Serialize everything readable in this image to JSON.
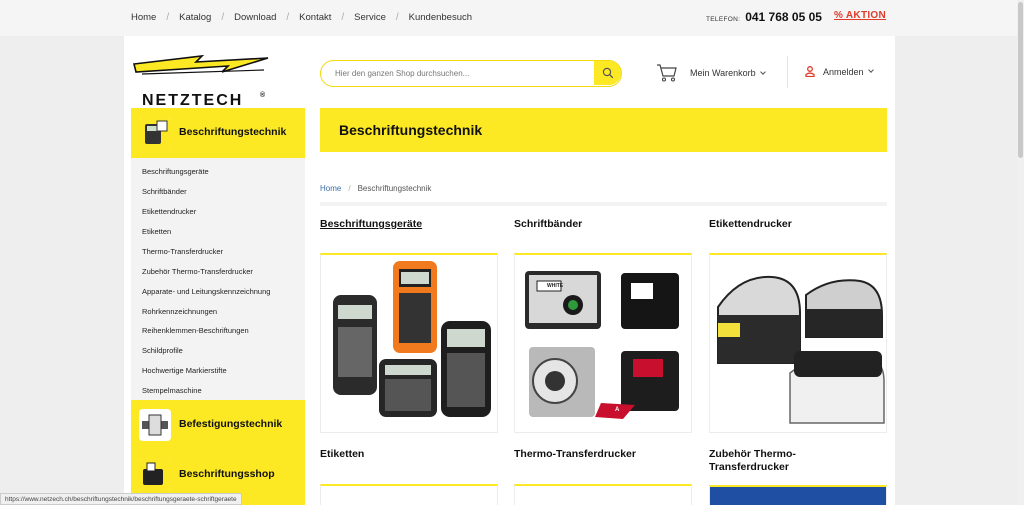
{
  "topnav": {
    "items": [
      "Home",
      "Katalog",
      "Download",
      "Kontakt",
      "Service",
      "Kundenbesuch"
    ],
    "phone_label": "TELEFON:",
    "phone_number": "041 768 05 05",
    "aktion": "% AKTION"
  },
  "header": {
    "logo_text": "NETZTECH",
    "search_placeholder": "Hier den ganzen Shop durchsuchen...",
    "cart_label": "Mein Warenkorb",
    "login_label": "Anmelden"
  },
  "sidebar": {
    "categories": [
      "Beschriftungstechnik",
      "Befestigungstechnik",
      "Beschriftungsshop"
    ],
    "subitems": [
      "Beschriftungsgeräte",
      "Schriftbänder",
      "Etikettendrucker",
      "Etiketten",
      "Thermo-Transferdrucker",
      "Zubehör Thermo-Transferdrucker",
      "Apparate- und Leitungskennzeichnung",
      "Rohrkennzeichnungen",
      "Reihenklemmen-Beschriftungen",
      "Schildprofile",
      "Hochwertige Markierstifte",
      "Stempelmaschine"
    ]
  },
  "main": {
    "page_title": "Beschriftungstechnik",
    "breadcrumb": {
      "home": "Home",
      "sep": "/",
      "current": "Beschriftungstechnik"
    },
    "products": [
      "Beschriftungsgeräte",
      "Schriftbänder",
      "Etikettendrucker",
      "Etiketten",
      "Thermo-Transferdrucker",
      "Zubehör Thermo-Transferdrucker"
    ],
    "tape_label": "WHITE",
    "printer_tag": "A"
  },
  "status_url": "https://www.netzech.ch/beschriftungstechnik/beschriftungsgeraete-schriftgeraete",
  "colors": {
    "accent_yellow": "#fde923",
    "aktion_red": "#e03c2c",
    "link_blue": "#3a6ea5"
  },
  "icons": [
    "search-icon",
    "cart-icon",
    "user-icon",
    "chevron-down-icon"
  ]
}
